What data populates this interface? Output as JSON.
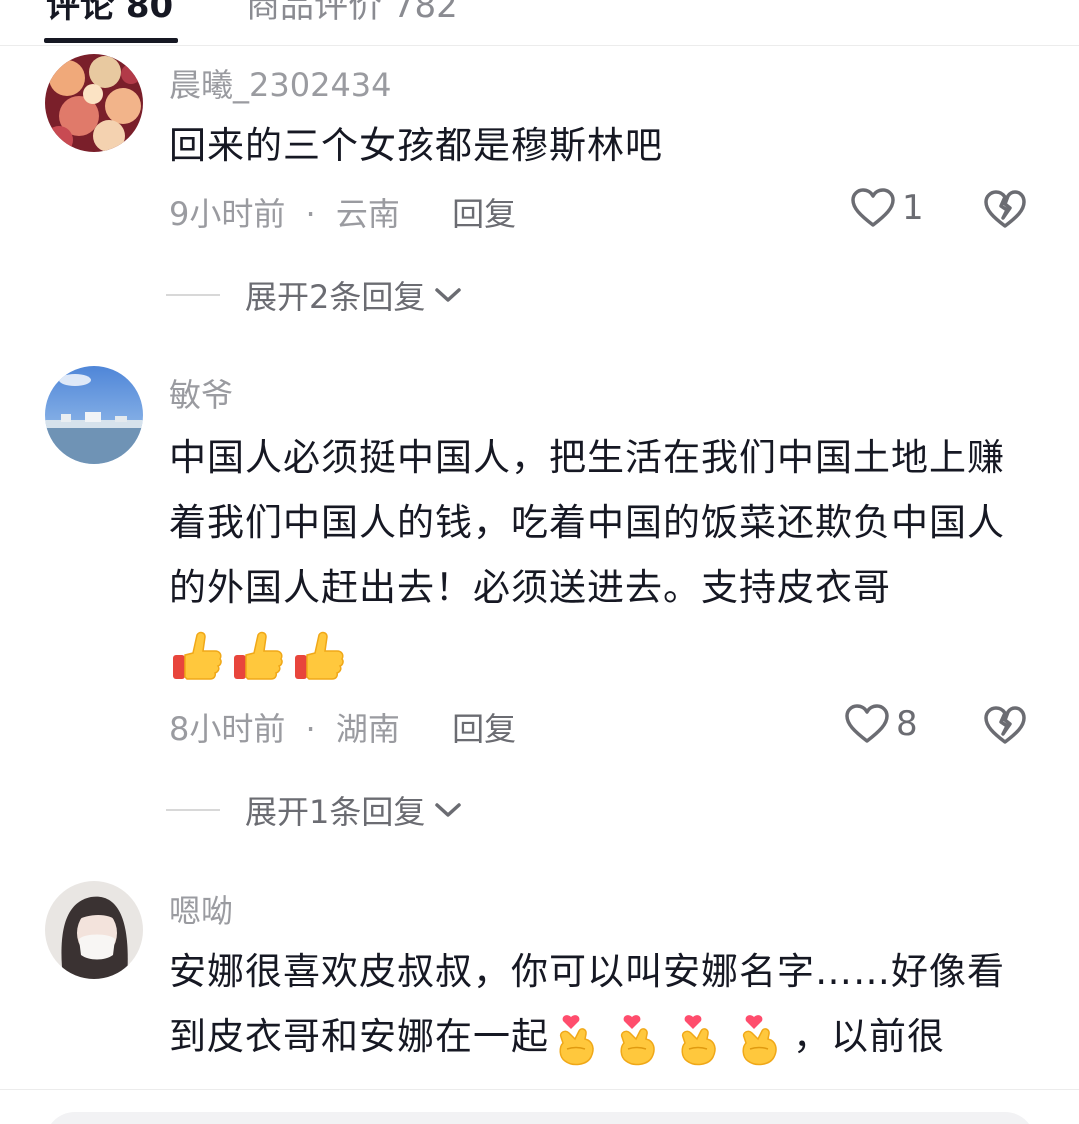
{
  "tabs": {
    "active": "评论 80",
    "inactive": "商品评价 782"
  },
  "comments": [
    {
      "username": "晨曦_2302434",
      "text": "回来的三个女孩都是穆斯林吧",
      "time": "9小时前",
      "location": "云南",
      "reply": "回复",
      "likes": "1",
      "expand": "展开2条回复"
    },
    {
      "username": "敏爷",
      "text": "中国人必须挺中国人，把生活在我们中国土地上赚着我们中国人的钱，吃着中国的饭菜还欺负中国人的外国人赶出去！必须送进去。支持皮衣哥",
      "emoji_count": 3,
      "emoji": "thumbs-up-icon",
      "time": "8小时前",
      "location": "湖南",
      "reply": "回复",
      "likes": "8",
      "expand": "展开1条回复"
    },
    {
      "username": "嗯呦",
      "text_part1": "安娜很喜欢皮叔叔，你可以叫安娜名字……好像看到皮衣哥和安娜在一起",
      "emoji": "finger-heart-icon",
      "emoji_count": 4,
      "text_part2": "，以前很"
    }
  ],
  "separator": "·",
  "colors": {
    "text": "#161823",
    "secondary": "#9a9ba0",
    "action": "#6b6c72"
  }
}
